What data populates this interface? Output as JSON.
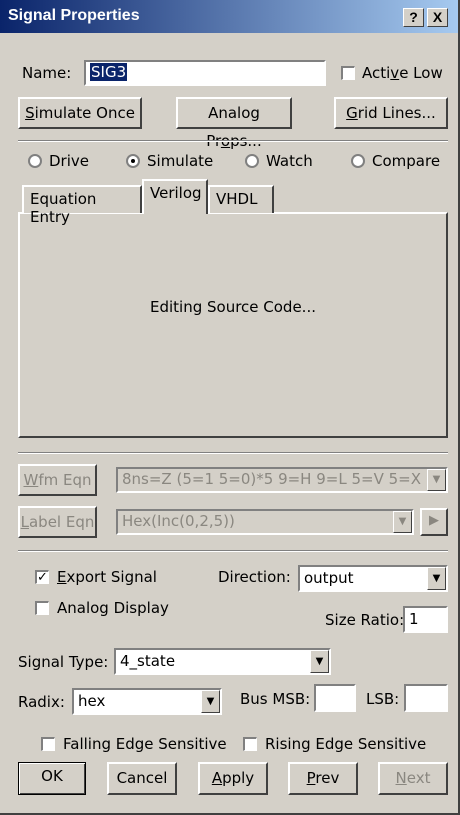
{
  "window": {
    "title": "Signal Properties",
    "help_label": "?",
    "close_label": "X"
  },
  "name": {
    "label": "Name:",
    "value": "SIG3"
  },
  "active_low": {
    "label_pre": "Acti",
    "label_u": "v",
    "label_post": "e Low",
    "checked": false
  },
  "buttons": {
    "simulate_once_u": "S",
    "simulate_once": "imulate Once",
    "analog_props_pre": "Analog Pr",
    "analog_props_u": "o",
    "analog_props_post": "ps...",
    "grid_lines_u": "G",
    "grid_lines": "rid Lines..."
  },
  "modes": {
    "drive": "Drive",
    "simulate": "Simulate",
    "watch": "Watch",
    "compare": "Compare",
    "selected": "simulate"
  },
  "tabs": {
    "equation_entry": "Equation Entry",
    "verilog": "Verilog",
    "vhdl": "VHDL",
    "active": "verilog"
  },
  "panel": {
    "message": "Editing Source Code..."
  },
  "wfm": {
    "button_u": "W",
    "button": "fm Eqn",
    "value": "8ns=Z (5=1 5=0)*5 9=H 9=L 5=V 5=X"
  },
  "label_eqn": {
    "button_u": "L",
    "button": "abel Eqn",
    "value": "Hex(Inc(0,2,5))",
    "step_icon": "play-right-icon"
  },
  "export_signal": {
    "label_u": "E",
    "label": "xport Signal",
    "checked": true
  },
  "analog_display": {
    "label": "Analog Display",
    "checked": false
  },
  "direction": {
    "label": "Direction:",
    "value": "output"
  },
  "size_ratio": {
    "label": "Size Ratio:",
    "value": "1"
  },
  "signal_type": {
    "label": "Signal Type:",
    "value": "4_state"
  },
  "radix": {
    "label": "Radix:",
    "value": "hex"
  },
  "bus_msb": {
    "label": "Bus MSB:",
    "value": ""
  },
  "lsb": {
    "label": "LSB:",
    "value": ""
  },
  "falling_edge": {
    "label": "Falling Edge Sensitive",
    "checked": false
  },
  "rising_edge": {
    "label": "Rising Edge Sensitive",
    "checked": false
  },
  "footer": {
    "ok": "OK",
    "cancel": "Cancel",
    "apply_u": "A",
    "apply": "pply",
    "prev_u": "P",
    "prev": "rev",
    "next_u": "N",
    "next": "ext"
  }
}
